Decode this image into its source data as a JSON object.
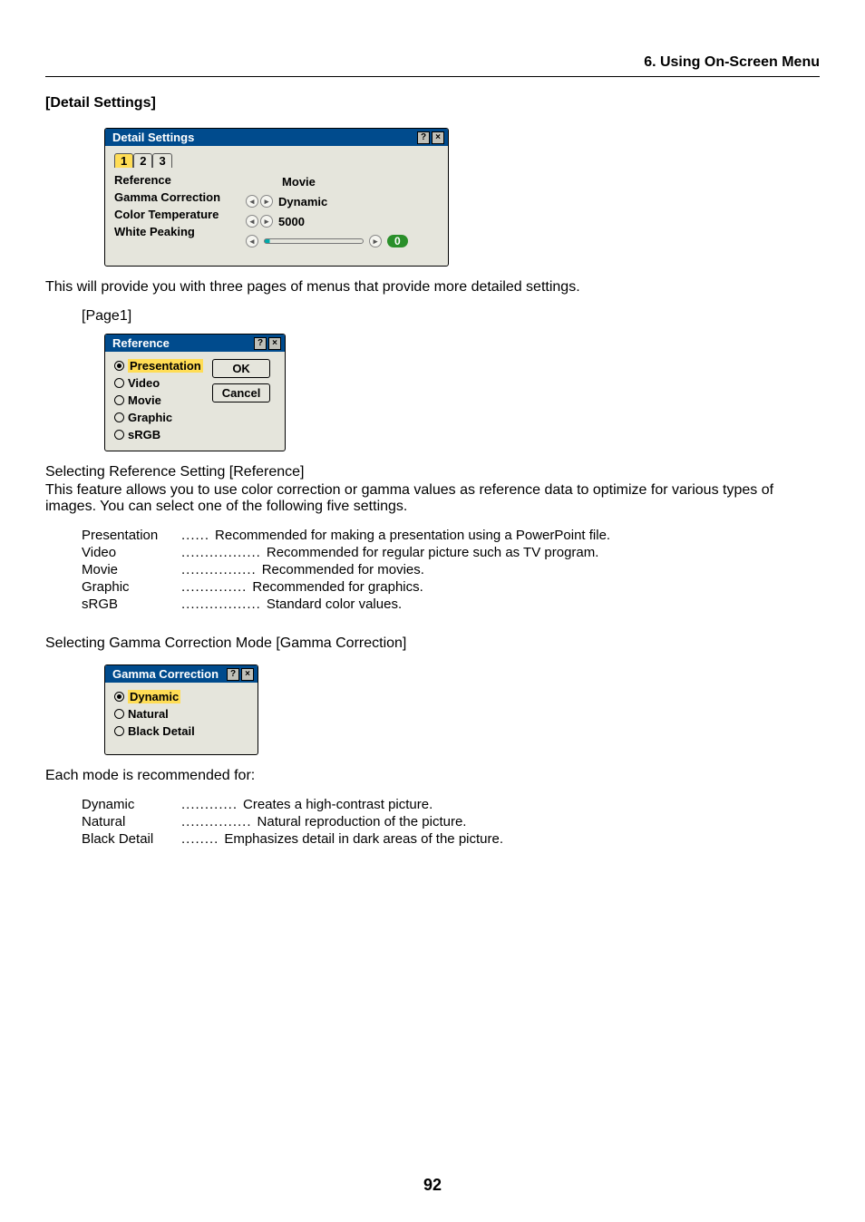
{
  "chapter": "6. Using On-Screen Menu",
  "section_title": "[Detail Settings]",
  "detail_dialog": {
    "title": "Detail Settings",
    "tabs": [
      "1",
      "2",
      "3"
    ],
    "active_tab": 0,
    "rows": {
      "reference_label": "Reference",
      "reference_value": "Movie",
      "gamma_label": "Gamma Correction",
      "gamma_value": "Dynamic",
      "colortemp_label": "Color Temperature",
      "colortemp_value": "5000",
      "whitepeak_label": "White Peaking",
      "whitepeak_value": "0"
    }
  },
  "intro_text": "This will provide you with three pages of menus that provide more detailed settings.",
  "page1_label": "[Page1]",
  "reference_dialog": {
    "title": "Reference",
    "options": [
      "Presentation",
      "Video",
      "Movie",
      "Graphic",
      "sRGB"
    ],
    "selected": 0,
    "ok": "OK",
    "cancel": "Cancel"
  },
  "ref_heading": "Selecting Reference Setting [Reference]",
  "ref_body": "This feature allows you to use color correction or gamma values as reference data to optimize for various types of images. You can select one of the following five settings.",
  "ref_defs": [
    {
      "term": "Presentation",
      "dots": "......",
      "desc": "Recommended for making a presentation using a PowerPoint file."
    },
    {
      "term": "Video",
      "dots": ".................",
      "desc": "Recommended for regular picture such as TV program."
    },
    {
      "term": "Movie",
      "dots": "................",
      "desc": "Recommended for movies."
    },
    {
      "term": "Graphic",
      "dots": "..............",
      "desc": "Recommended for graphics."
    },
    {
      "term": "sRGB",
      "dots": ".................",
      "desc": "Standard color values."
    }
  ],
  "gamma_heading": "Selecting Gamma Correction Mode [Gamma Correction]",
  "gamma_dialog": {
    "title": "Gamma Correction",
    "options": [
      "Dynamic",
      "Natural",
      "Black Detail"
    ],
    "selected": 0
  },
  "gamma_intro": "Each mode is recommended for:",
  "gamma_defs": [
    {
      "term": "Dynamic",
      "dots": "............",
      "desc": "Creates a high-contrast picture."
    },
    {
      "term": "Natural",
      "dots": "...............",
      "desc": "Natural reproduction of the picture."
    },
    {
      "term": "Black Detail",
      "dots": "........",
      "desc": "Emphasizes detail in dark areas of the picture."
    }
  ],
  "page_number": "92"
}
